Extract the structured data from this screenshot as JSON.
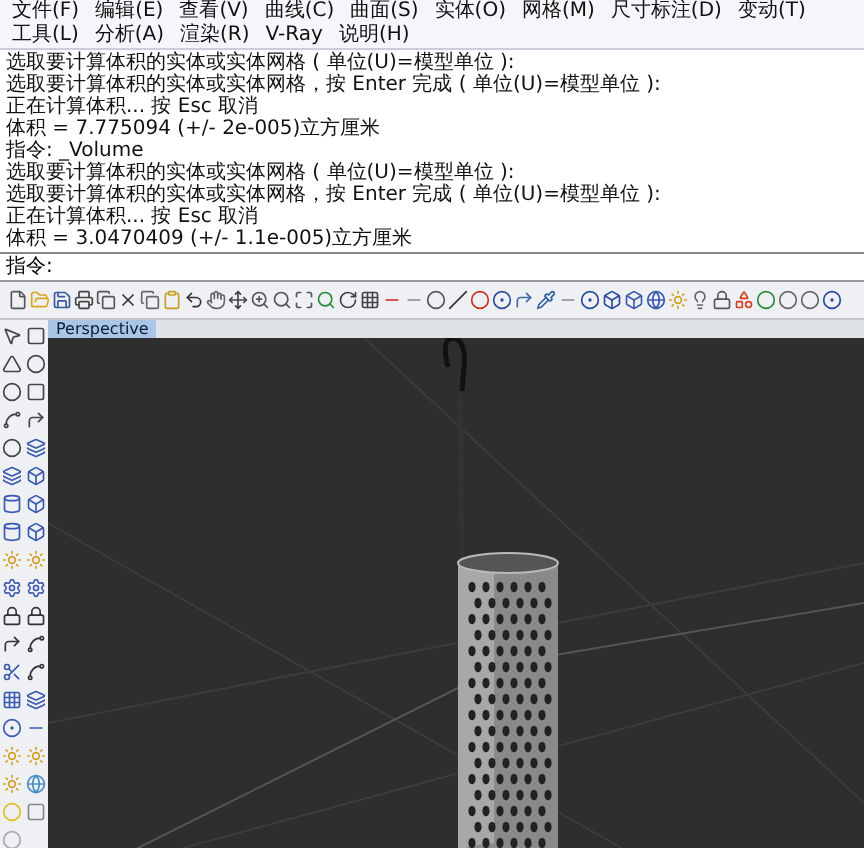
{
  "menu": [
    {
      "label": "文件(F)"
    },
    {
      "label": "编辑(E)"
    },
    {
      "label": "查看(V)"
    },
    {
      "label": "曲线(C)"
    },
    {
      "label": "曲面(S)"
    },
    {
      "label": "实体(O)"
    },
    {
      "label": "网格(M)"
    },
    {
      "label": "尺寸标注(D)"
    },
    {
      "label": "变动(T)"
    },
    {
      "label": "工具(L)"
    },
    {
      "label": "分析(A)"
    },
    {
      "label": "渲染(R)"
    },
    {
      "label": "V-Ray"
    },
    {
      "label": "说明(H)"
    }
  ],
  "command_history": [
    "选取要计算体积的实体或实体网格 ( 单位(U)=模型单位 ):",
    "选取要计算体积的实体或实体网格，按 Enter 完成 ( 单位(U)=模型单位 ):",
    "正在计算体积... 按 Esc 取消",
    "体积 = 7.775094 (+/- 2e-005)立方厘米",
    "指令: _Volume",
    "选取要计算体积的实体或实体网格 ( 单位(U)=模型单位 ):",
    "选取要计算体积的实体或实体网格，按 Enter 完成 ( 单位(U)=模型单位 ):",
    "正在计算体积... 按 Esc 取消",
    "体积 = 3.0470409 (+/- 1.1e-005)立方厘米"
  ],
  "command_prompt": "指令:",
  "viewport": {
    "label": "Perspective"
  }
}
